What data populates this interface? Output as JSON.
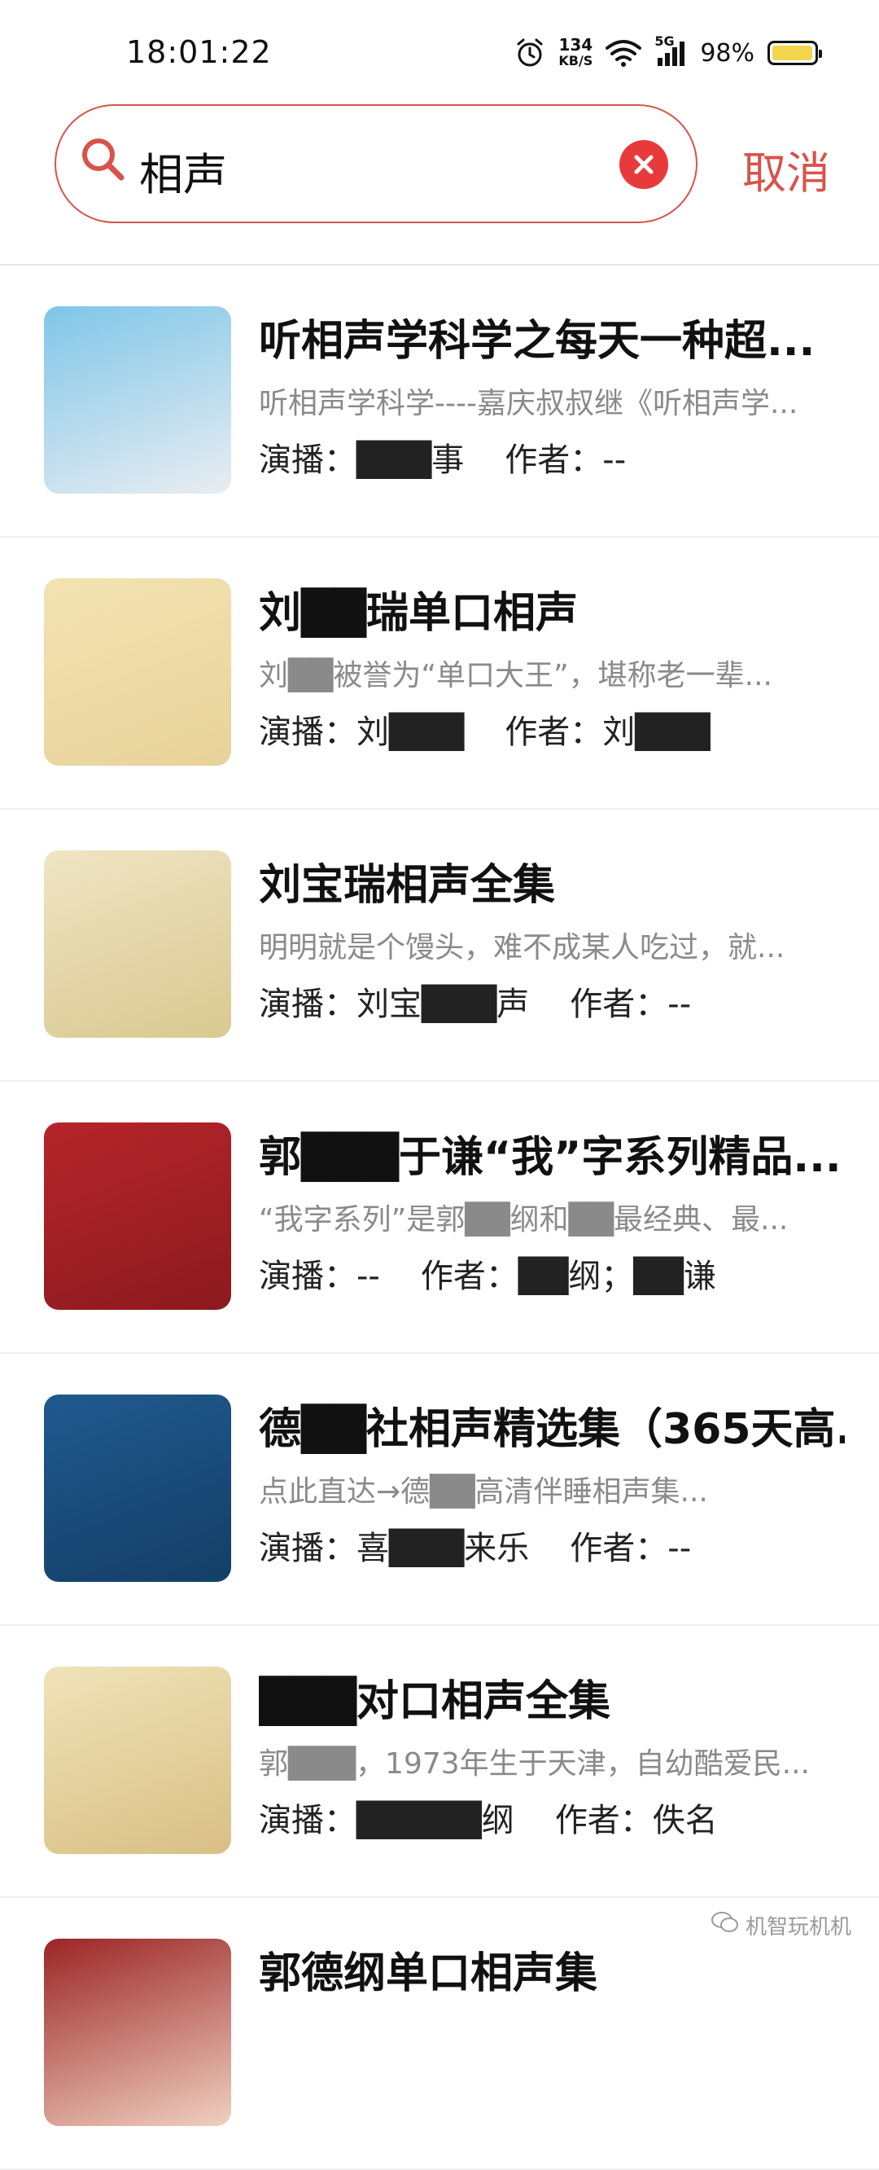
{
  "status_bar": {
    "time": "18:01:22",
    "net_speed_value": "134",
    "net_speed_unit": "KB/S",
    "network_type": "5G",
    "battery_percent": "98%",
    "battery_level": 0.98,
    "battery_color": "#f2d54a"
  },
  "search": {
    "query": "相声",
    "cancel_label": "取消",
    "accent_color": "#d8534a"
  },
  "results": [
    {
      "title": "听相声学科学之每天一种超...",
      "desc": "听相声学科学----嘉庆叔叔继《听相声学...",
      "performer_label": "演播：",
      "performer": "███事",
      "author_label": "作者：",
      "author": "--",
      "cover_colors": [
        "#7fc6e8",
        "#e9edf2"
      ]
    },
    {
      "title": "刘██瑞单口相声",
      "desc": "刘██被誉为“单口大王”，堪称老一辈...",
      "performer_label": "演播：",
      "performer": "刘███",
      "author_label": "作者：",
      "author": "刘███",
      "cover_colors": [
        "#f3e3b3",
        "#e8d29a"
      ]
    },
    {
      "title": "刘宝瑞相声全集",
      "desc": "明明就是个馒头，难不成某人吃过，就...",
      "performer_label": "演播：",
      "performer": "刘宝███声",
      "author_label": "作者：",
      "author": "--",
      "cover_colors": [
        "#efe5c4",
        "#d9c890"
      ]
    },
    {
      "title": "郭███于谦“我”字系列精品...",
      "desc": "“我字系列”是郭██纲和██最经典、最...",
      "performer_label": "演播：",
      "performer": "--",
      "author_label": "作者：",
      "author": "██纲；██谦",
      "cover_colors": [
        "#b5252a",
        "#8c1a1e"
      ]
    },
    {
      "title": "德██社相声精选集（365天高...",
      "desc": "点此直达→德██高清伴睡相声集...",
      "performer_label": "演播：",
      "performer": "喜███来乐",
      "author_label": "作者：",
      "author": "--",
      "cover_colors": [
        "#1f5a8f",
        "#143e66"
      ]
    },
    {
      "title": "███对口相声全集",
      "desc": "郭███，1973年生于天津，自幼酷爱民...",
      "performer_label": "演播：",
      "performer": "█████纲",
      "author_label": "作者：",
      "author": "佚名",
      "cover_colors": [
        "#efe3b8",
        "#d9bf85"
      ]
    },
    {
      "title": "郭德纲单口相声集",
      "desc": "",
      "performer_label": "",
      "performer": "",
      "author_label": "",
      "author": "",
      "cover_colors": [
        "#9b2525",
        "#f0d0c0"
      ]
    }
  ],
  "watermark": "机智玩机机"
}
